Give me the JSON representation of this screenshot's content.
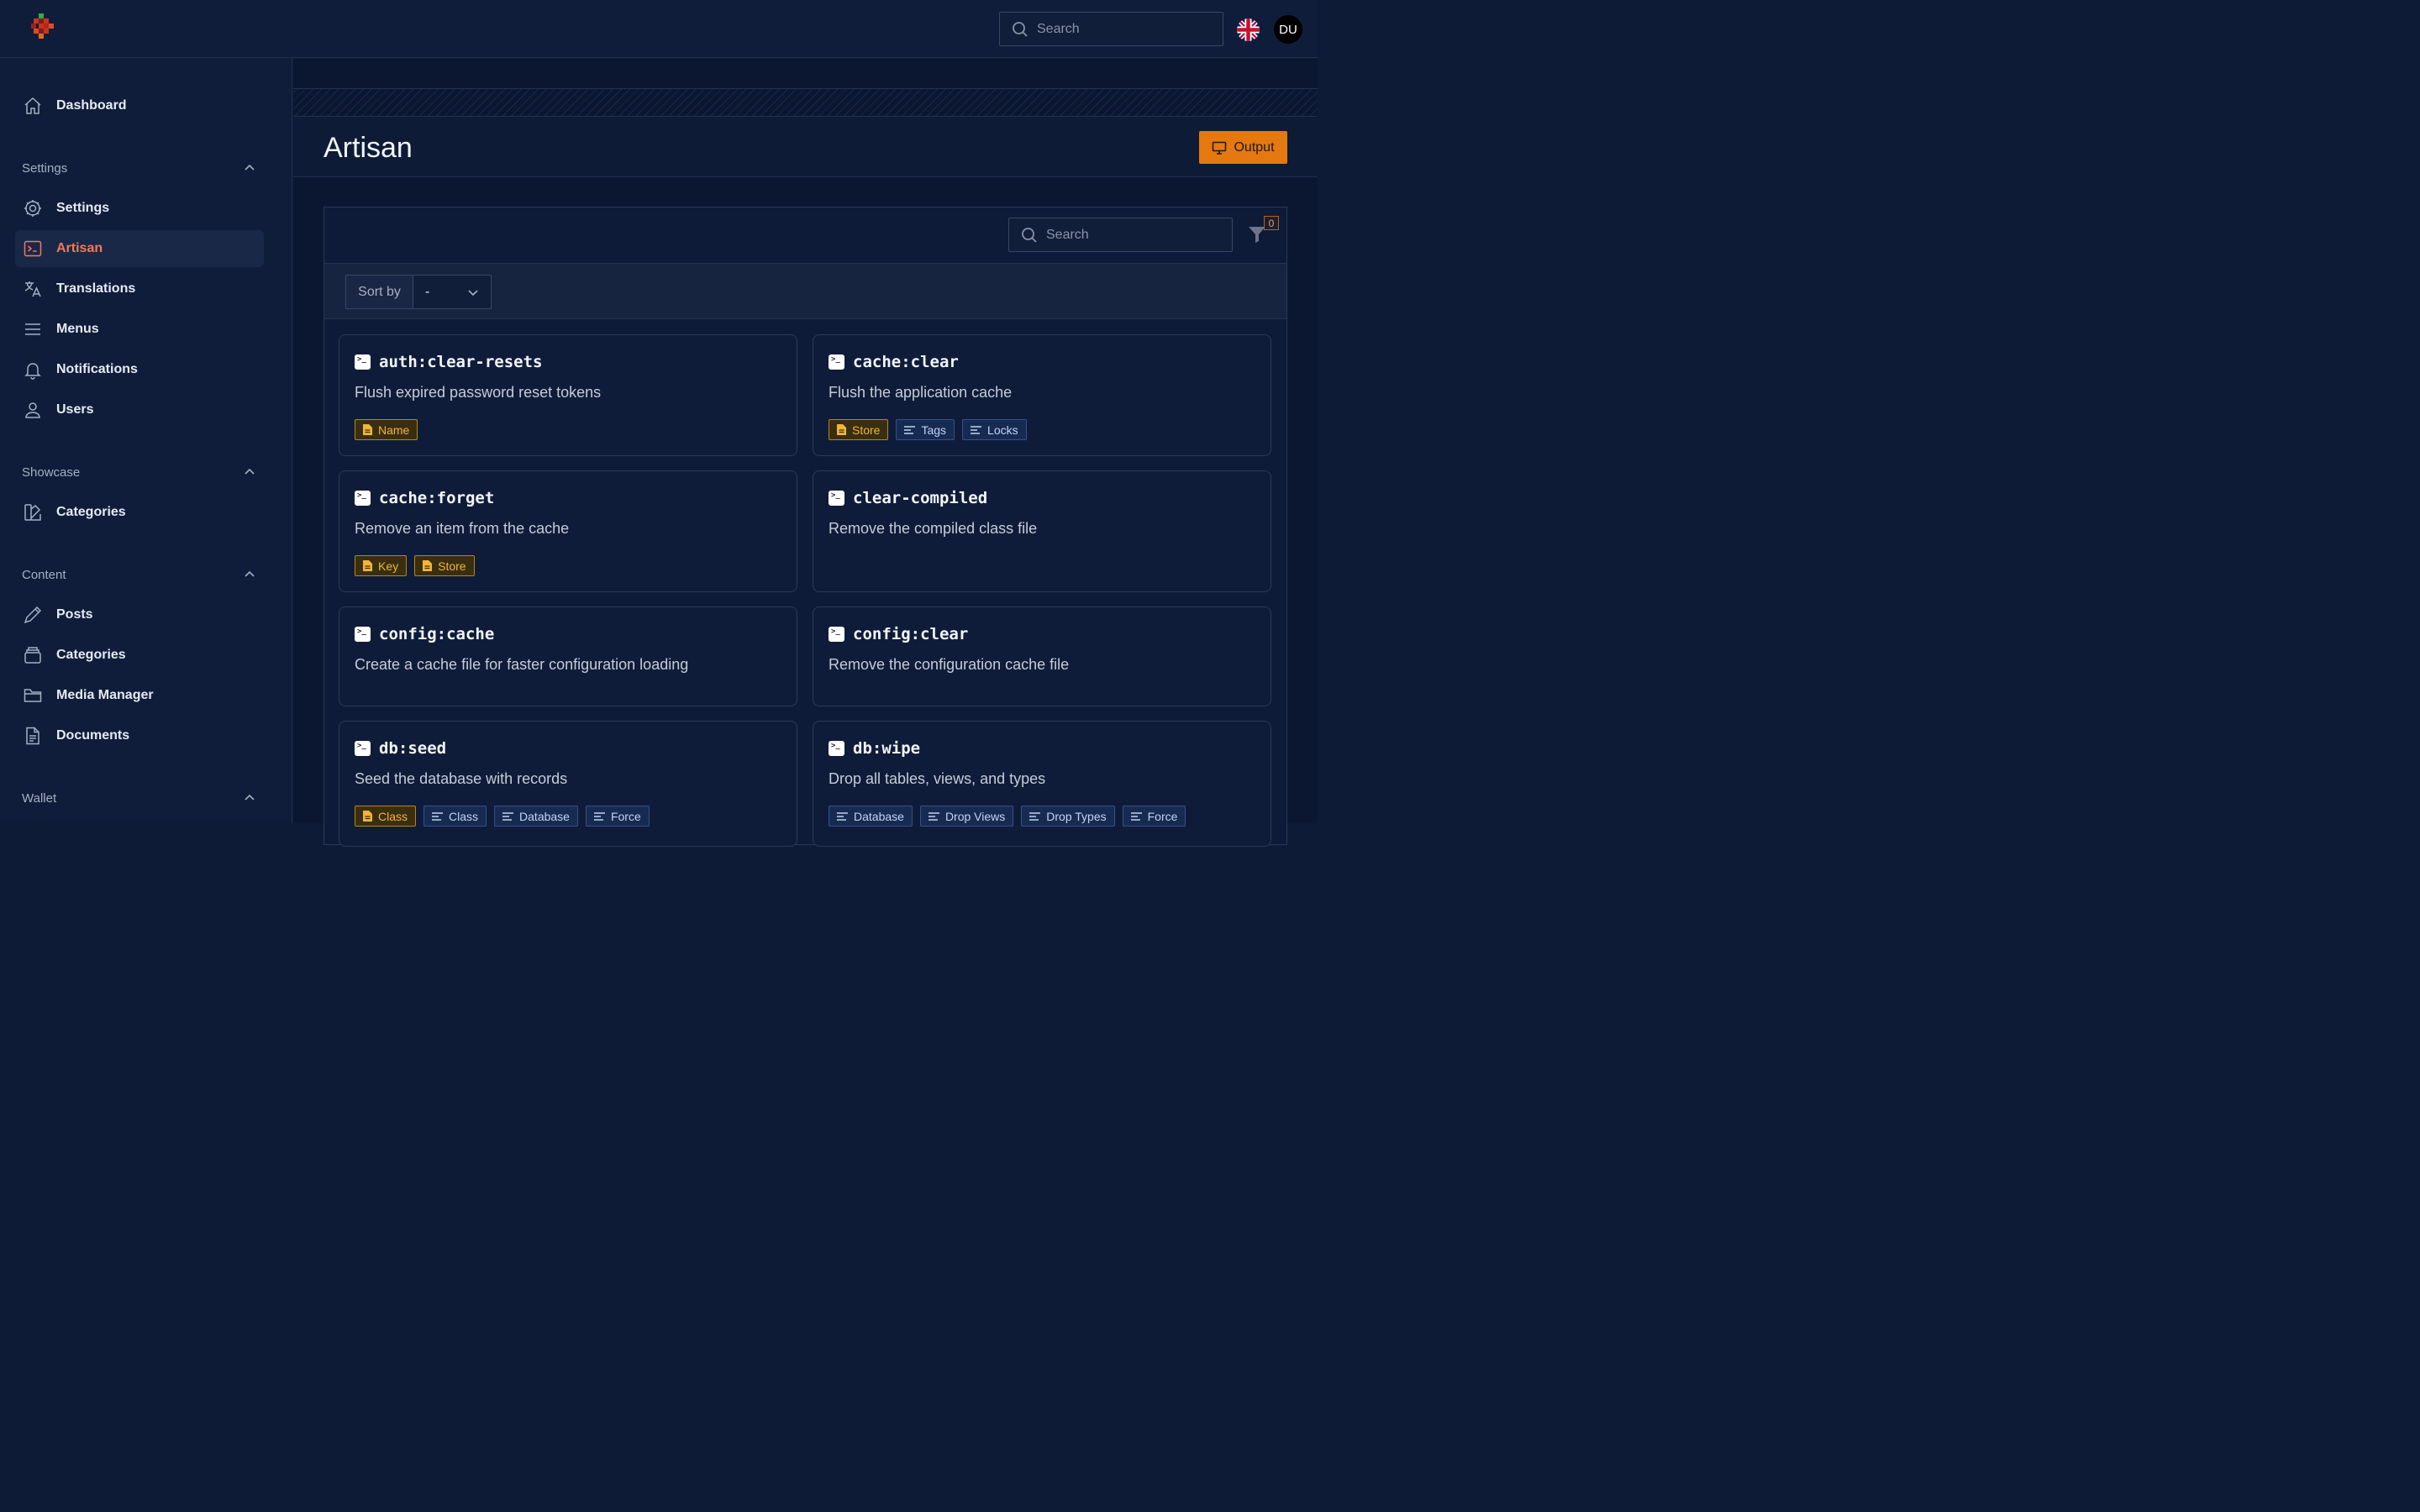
{
  "topbar": {
    "search_placeholder": "Search",
    "avatar_initials": "DU",
    "language_flag": "uk-flag-icon"
  },
  "sidebar": {
    "dashboard": "Dashboard",
    "groups": {
      "settings": "Settings",
      "showcase": "Showcase",
      "content": "Content",
      "wallet": "Wallet"
    },
    "items": {
      "settings": "Settings",
      "artisan": "Artisan",
      "translations": "Translations",
      "menus": "Menus",
      "notifications": "Notifications",
      "users": "Users",
      "showcase_categories": "Categories",
      "posts": "Posts",
      "content_categories": "Categories",
      "media_manager": "Media Manager",
      "documents": "Documents"
    },
    "active_item": "Artisan",
    "active_color": "#ee7a5b"
  },
  "page": {
    "title": "Artisan",
    "output_button": "Output",
    "output_color": "#e5780e"
  },
  "table": {
    "search_placeholder": "Search",
    "filter_count": "0",
    "sort_label": "Sort by",
    "sort_value": "-"
  },
  "commands": [
    {
      "name": "auth:clear-resets",
      "description": "Flush expired password reset tokens",
      "arguments": [
        "Name"
      ],
      "options": []
    },
    {
      "name": "cache:clear",
      "description": "Flush the application cache",
      "arguments": [
        "Store"
      ],
      "options": [
        "Tags",
        "Locks"
      ]
    },
    {
      "name": "cache:forget",
      "description": "Remove an item from the cache",
      "arguments": [
        "Key",
        "Store"
      ],
      "options": []
    },
    {
      "name": "clear-compiled",
      "description": "Remove the compiled class file",
      "arguments": [],
      "options": []
    },
    {
      "name": "config:cache",
      "description": "Create a cache file for faster configuration loading",
      "arguments": [],
      "options": []
    },
    {
      "name": "config:clear",
      "description": "Remove the configuration cache file",
      "arguments": [],
      "options": []
    },
    {
      "name": "db:seed",
      "description": "Seed the database with records",
      "arguments": [
        "Class"
      ],
      "options": [
        "Class",
        "Database",
        "Force"
      ]
    },
    {
      "name": "db:wipe",
      "description": "Drop all tables, views, and types",
      "arguments": [],
      "options": [
        "Database",
        "Drop Views",
        "Drop Types",
        "Force"
      ]
    }
  ]
}
